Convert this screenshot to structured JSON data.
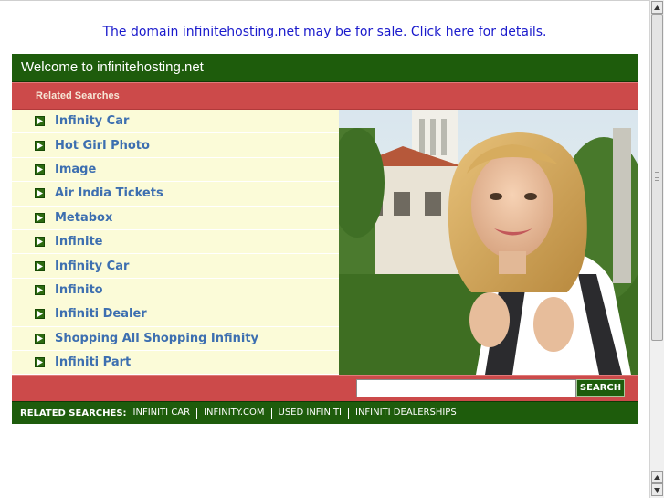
{
  "sale_notice": "The domain infinitehosting.net may be for sale. Click here for details.",
  "header": {
    "title": "Welcome to infinitehosting.net"
  },
  "related": {
    "label": "Related Searches"
  },
  "links": [
    "Infinity Car",
    "Hot Girl Photo",
    "Image",
    "Air India Tickets",
    "Metabox",
    "Infinite",
    "Infinity Car",
    "Infinito",
    "Infiniti Dealer",
    "Shopping All Shopping Infinity",
    "Infiniti Part"
  ],
  "search": {
    "button_label": "SEARCH",
    "value": ""
  },
  "footer": {
    "label": "RELATED SEARCHES:",
    "links": [
      "INFINITI CAR",
      "INFINITY.COM",
      "USED INFINITI",
      "INFINITI DEALERSHIPS"
    ]
  },
  "colors": {
    "green": "#1e5c0c",
    "red": "#cc4a4a",
    "link_blue": "#3d6fb0",
    "panel_yellow": "#fbfbd8"
  },
  "icons": {
    "bullet": "arrow-bullet-icon",
    "scroll_up": "scroll-up-arrow-icon",
    "scroll_down": "scroll-down-arrow-icon"
  }
}
